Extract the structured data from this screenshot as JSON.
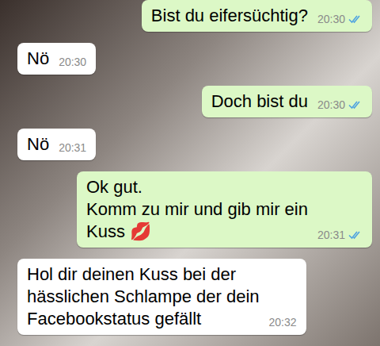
{
  "chat": {
    "messages": [
      {
        "kind": "outgoing",
        "lines": [
          "Bist du eifersüchtig?"
        ],
        "time": "20:30",
        "read": true
      },
      {
        "kind": "incoming",
        "lines": [
          "Nö"
        ],
        "time": "20:30"
      },
      {
        "kind": "outgoing",
        "lines": [
          "Doch bist du"
        ],
        "time": "20:30",
        "read": true
      },
      {
        "kind": "incoming",
        "lines": [
          "Nö"
        ],
        "time": "20:31"
      },
      {
        "kind": "outgoing",
        "lines": [
          "Ok gut.",
          "Komm zu mir und gib mir ein",
          "Kuss 💋"
        ],
        "time": "20:31",
        "read": true
      },
      {
        "kind": "incoming",
        "lines": [
          "Hol dir deinen Kuss bei der",
          "hässlichen Schlampe der dein",
          "Facebookstatus gefällt"
        ],
        "time": "20:32"
      }
    ]
  }
}
